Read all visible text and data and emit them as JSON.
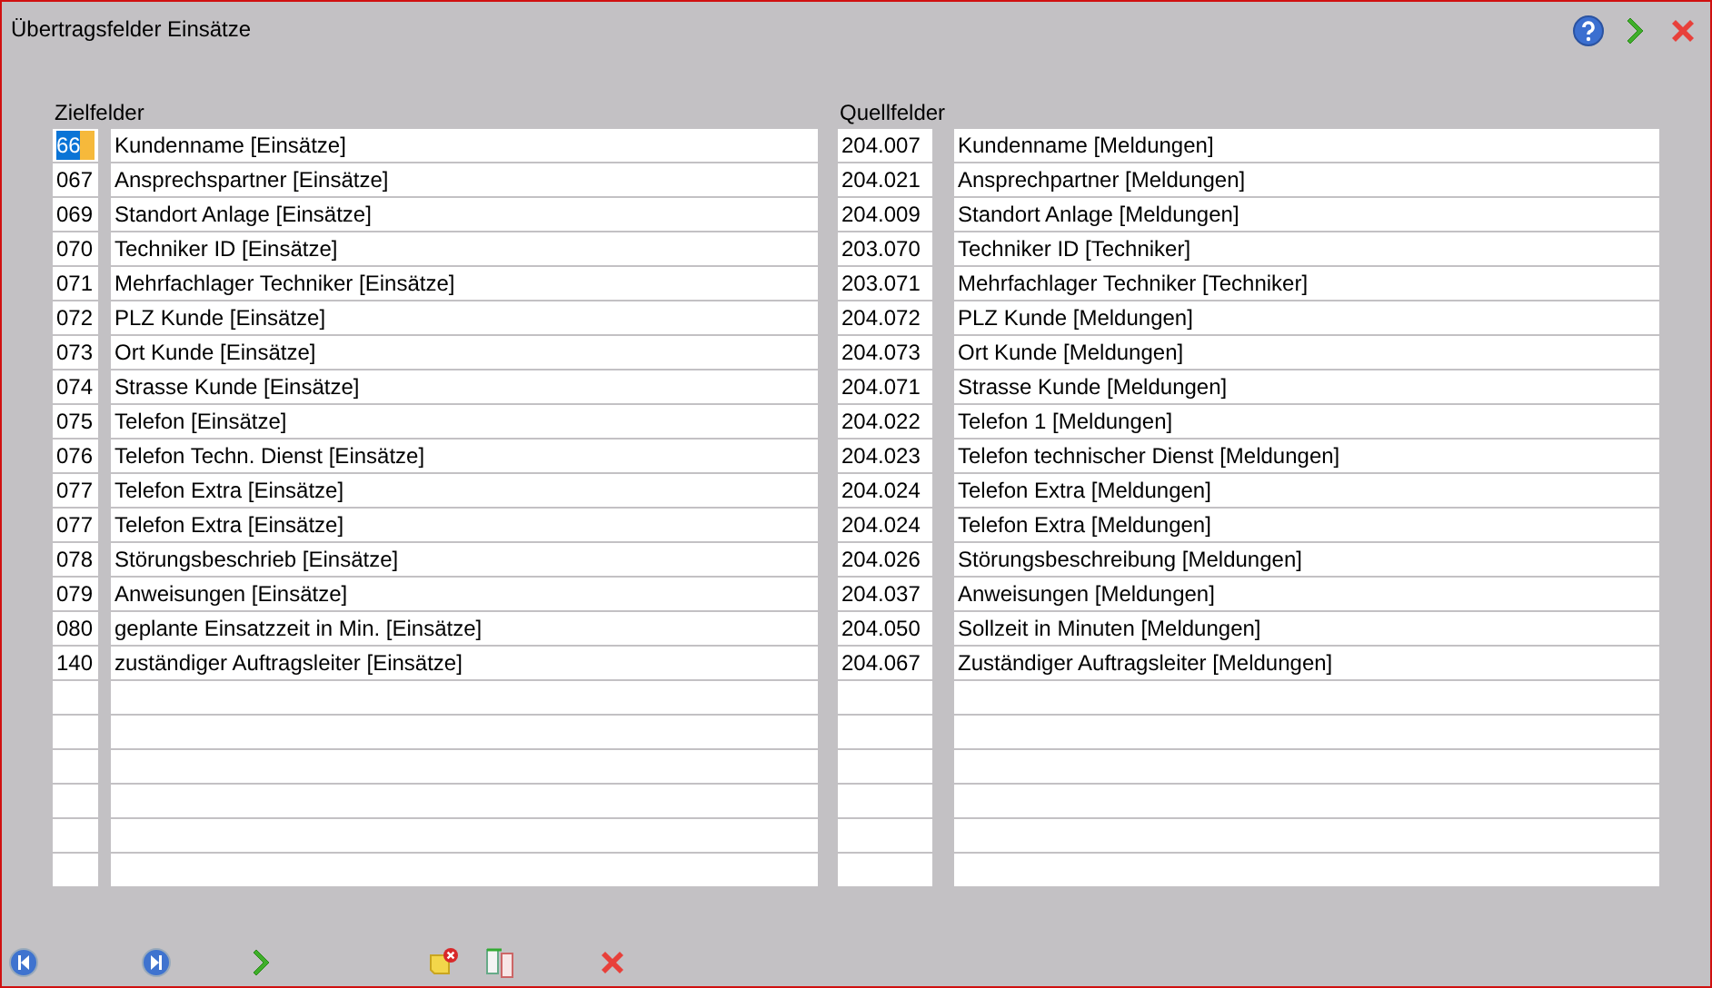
{
  "window": {
    "title": "Übertragsfelder Einsätze"
  },
  "target": {
    "heading": "Zielfelder",
    "rows": [
      {
        "code": "66",
        "name": "Kundenname [Einsätze]",
        "selected": true
      },
      {
        "code": "067",
        "name": "Ansprechspartner [Einsätze]",
        "selected": false
      },
      {
        "code": "069",
        "name": "Standort Anlage [Einsätze]",
        "selected": false
      },
      {
        "code": "070",
        "name": "Techniker ID [Einsätze]",
        "selected": false
      },
      {
        "code": "071",
        "name": "Mehrfachlager Techniker [Einsätze]",
        "selected": false
      },
      {
        "code": "072",
        "name": "PLZ Kunde [Einsätze]",
        "selected": false
      },
      {
        "code": "073",
        "name": "Ort Kunde [Einsätze]",
        "selected": false
      },
      {
        "code": "074",
        "name": "Strasse Kunde [Einsätze]",
        "selected": false
      },
      {
        "code": "075",
        "name": "Telefon [Einsätze]",
        "selected": false
      },
      {
        "code": "076",
        "name": "Telefon Techn. Dienst [Einsätze]",
        "selected": false
      },
      {
        "code": "077",
        "name": "Telefon Extra [Einsätze]",
        "selected": false
      },
      {
        "code": "077",
        "name": "Telefon Extra [Einsätze]",
        "selected": false
      },
      {
        "code": "078",
        "name": "Störungsbeschrieb [Einsätze]",
        "selected": false
      },
      {
        "code": "079",
        "name": "Anweisungen [Einsätze]",
        "selected": false
      },
      {
        "code": "080",
        "name": "geplante Einsatzzeit in Min. [Einsätze]",
        "selected": false
      },
      {
        "code": "140",
        "name": "zuständiger Auftragsleiter [Einsätze]",
        "selected": false
      }
    ]
  },
  "source": {
    "heading": "Quellfelder",
    "rows": [
      {
        "code": "204.007",
        "name": "Kundenname [Meldungen]"
      },
      {
        "code": "204.021",
        "name": "Ansprechpartner [Meldungen]"
      },
      {
        "code": "204.009",
        "name": "Standort Anlage [Meldungen]"
      },
      {
        "code": "203.070",
        "name": "Techniker ID [Techniker]"
      },
      {
        "code": "203.071",
        "name": "Mehrfachlager Techniker [Techniker]"
      },
      {
        "code": "204.072",
        "name": "PLZ Kunde [Meldungen]"
      },
      {
        "code": "204.073",
        "name": "Ort Kunde [Meldungen]"
      },
      {
        "code": "204.071",
        "name": "Strasse Kunde [Meldungen]"
      },
      {
        "code": "204.022",
        "name": "Telefon 1 [Meldungen]"
      },
      {
        "code": "204.023",
        "name": "Telefon technischer Dienst [Meldungen]"
      },
      {
        "code": "204.024",
        "name": "Telefon Extra [Meldungen]"
      },
      {
        "code": "204.024",
        "name": "Telefon Extra [Meldungen]"
      },
      {
        "code": "204.026",
        "name": "Störungsbeschreibung [Meldungen]"
      },
      {
        "code": "204.037",
        "name": "Anweisungen [Meldungen]"
      },
      {
        "code": "204.050",
        "name": "Sollzeit in Minuten [Meldungen]"
      },
      {
        "code": "204.067",
        "name": "Zuständiger Auftragsleiter [Meldungen]"
      }
    ]
  }
}
